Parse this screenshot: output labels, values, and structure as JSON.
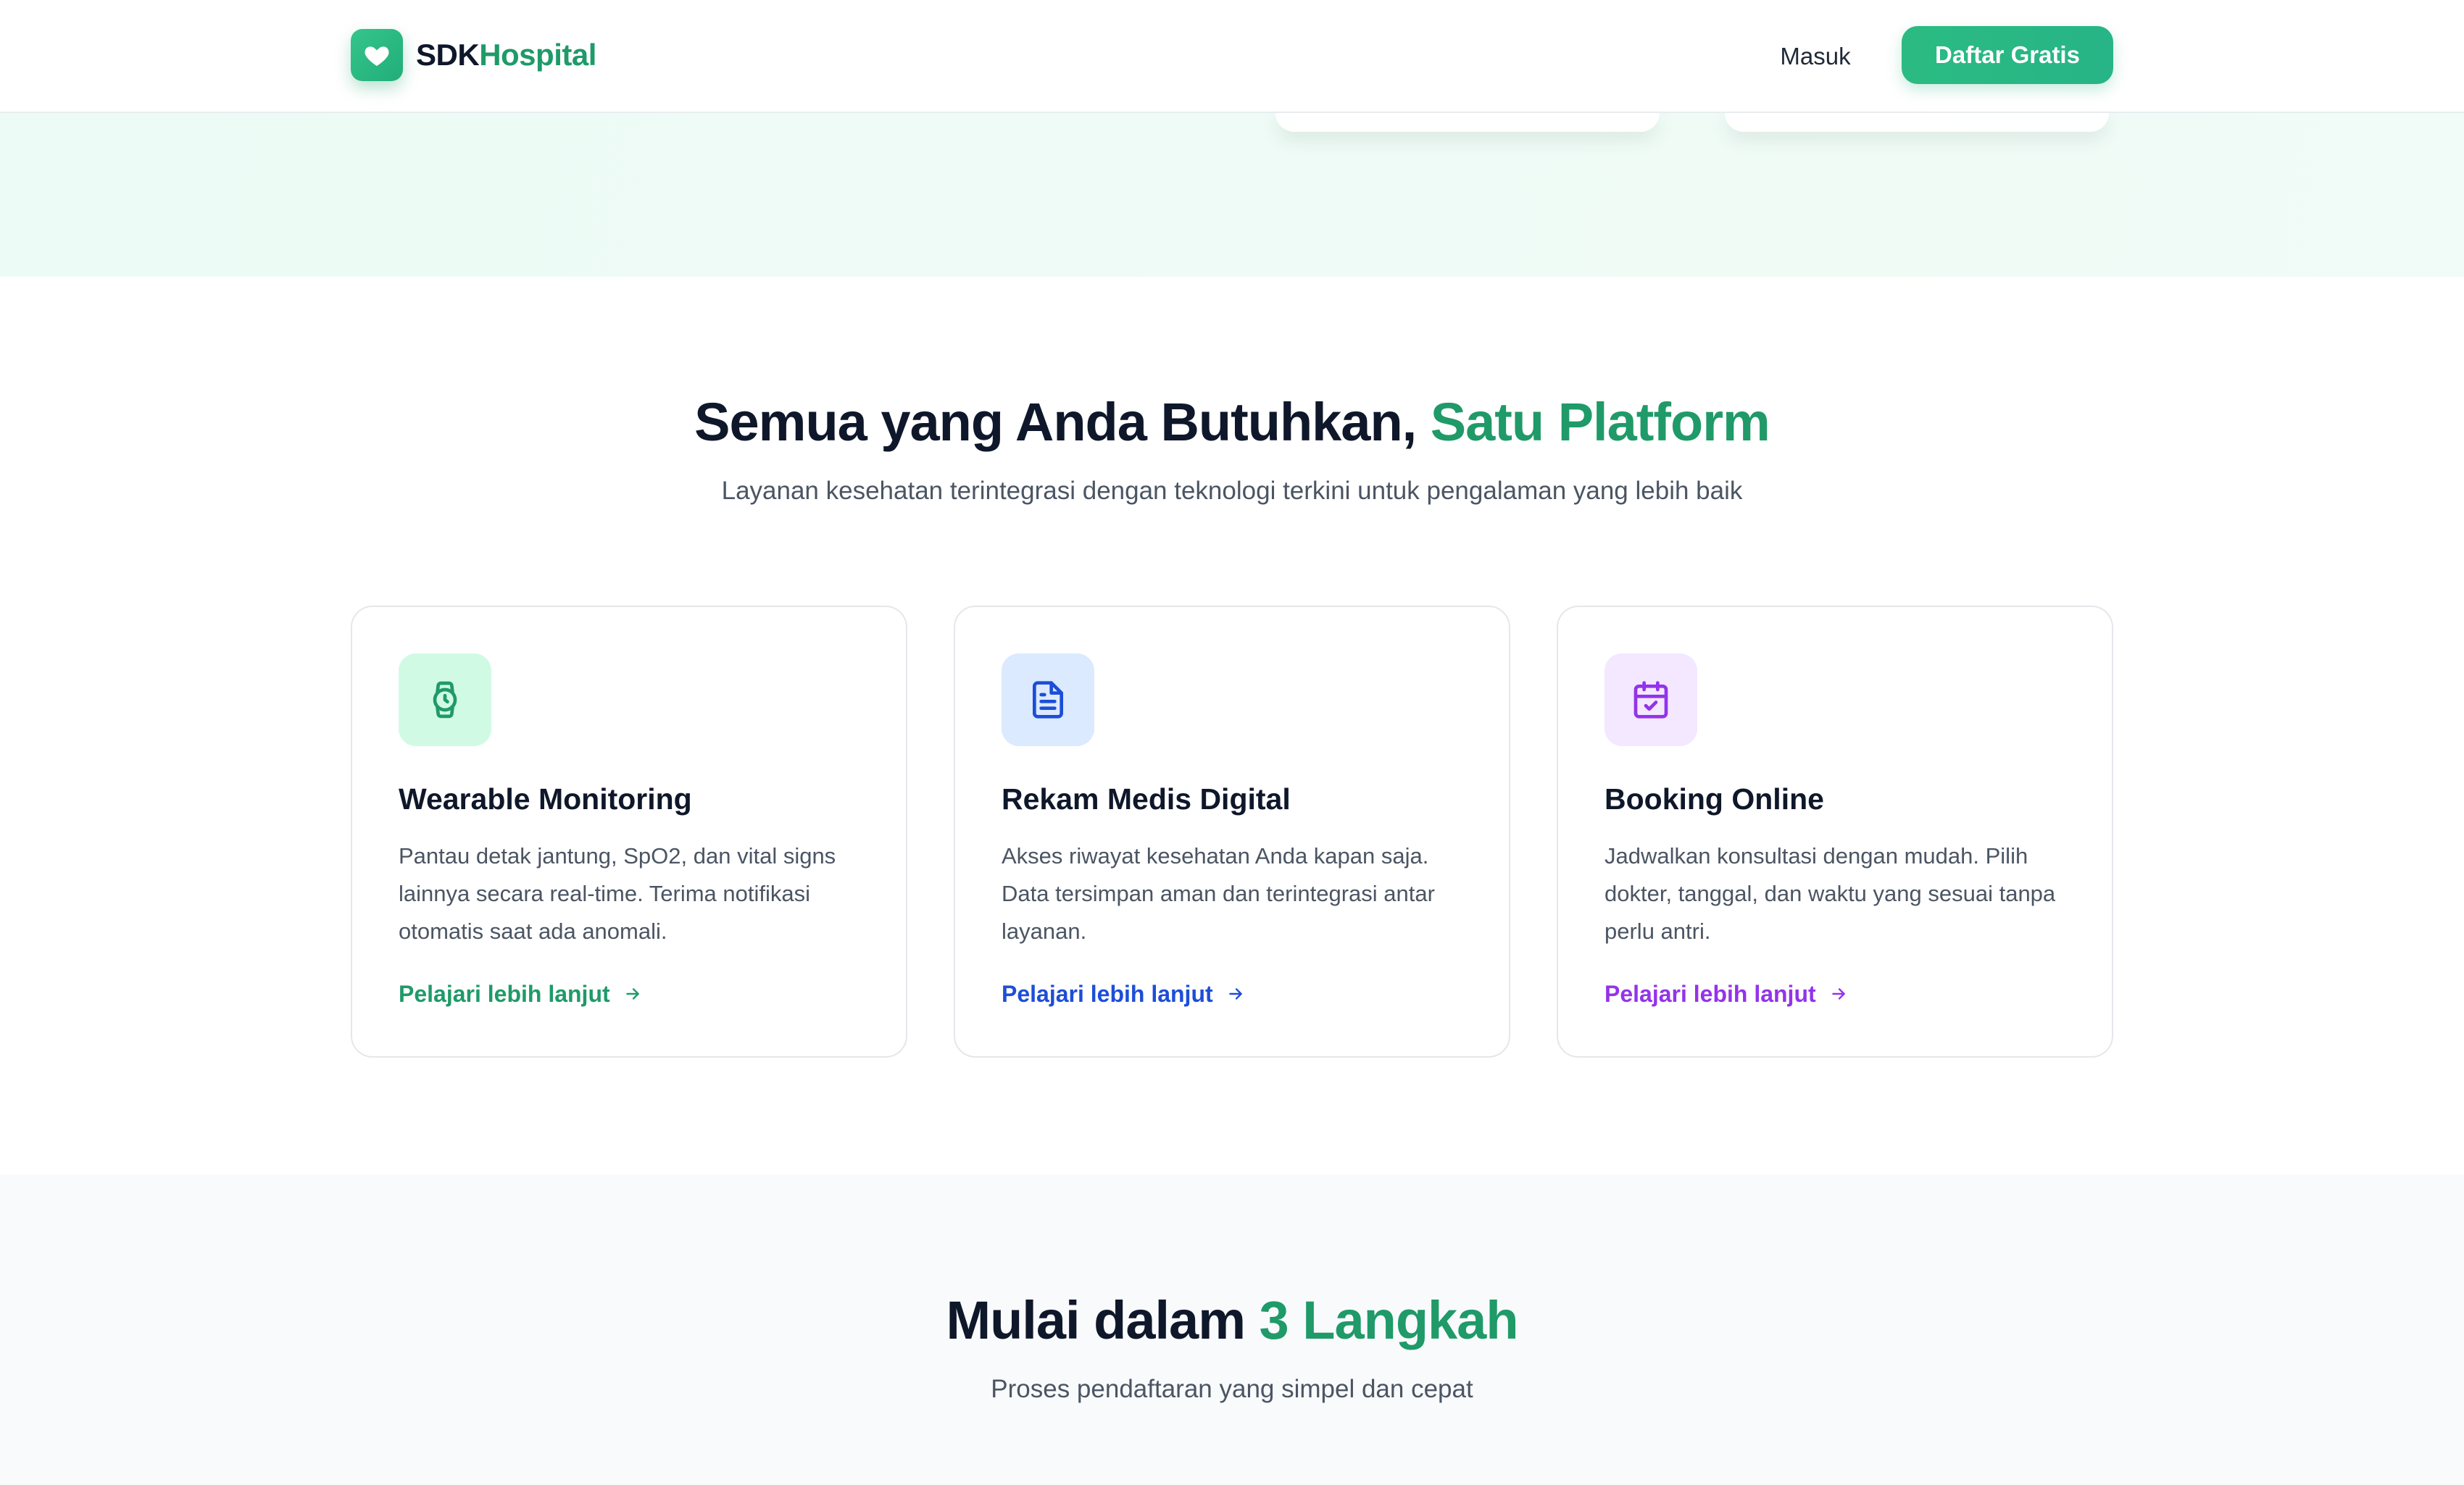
{
  "header": {
    "brand_part1": "SDK",
    "brand_part2": "Hospital",
    "login_label": "Masuk",
    "signup_label": "Daftar Gratis"
  },
  "features": {
    "title_main": "Semua yang Anda Butuhkan, ",
    "title_accent": "Satu Platform",
    "subtitle": "Layanan kesehatan terintegrasi dengan teknologi terkini untuk pengalaman yang lebih baik",
    "cards": [
      {
        "title": "Wearable Monitoring",
        "description": "Pantau detak jantung, SpO2, dan vital signs lainnya secara real-time. Terima notifikasi otomatis saat ada anomali.",
        "link": "Pelajari lebih lanjut",
        "icon": "watch-icon"
      },
      {
        "title": "Rekam Medis Digital",
        "description": "Akses riwayat kesehatan Anda kapan saja. Data tersimpan aman dan terintegrasi antar layanan.",
        "link": "Pelajari lebih lanjut",
        "icon": "document-icon"
      },
      {
        "title": "Booking Online",
        "description": "Jadwalkan konsultasi dengan mudah. Pilih dokter, tanggal, dan waktu yang sesuai tanpa perlu antri.",
        "link": "Pelajari lebih lanjut",
        "icon": "calendar-check-icon"
      }
    ]
  },
  "steps": {
    "title_main": "Mulai dalam ",
    "title_accent": "3 Langkah",
    "subtitle": "Proses pendaftaran yang simpel dan cepat"
  },
  "colors": {
    "brand_green": "#1f9a68",
    "button_green": "#2bbb82",
    "blue": "#1d4ed8",
    "purple": "#9333ea",
    "icon_bg_green": "#d1fae5",
    "icon_bg_blue": "#dbeafe",
    "icon_bg_purple": "#f3e8ff"
  }
}
